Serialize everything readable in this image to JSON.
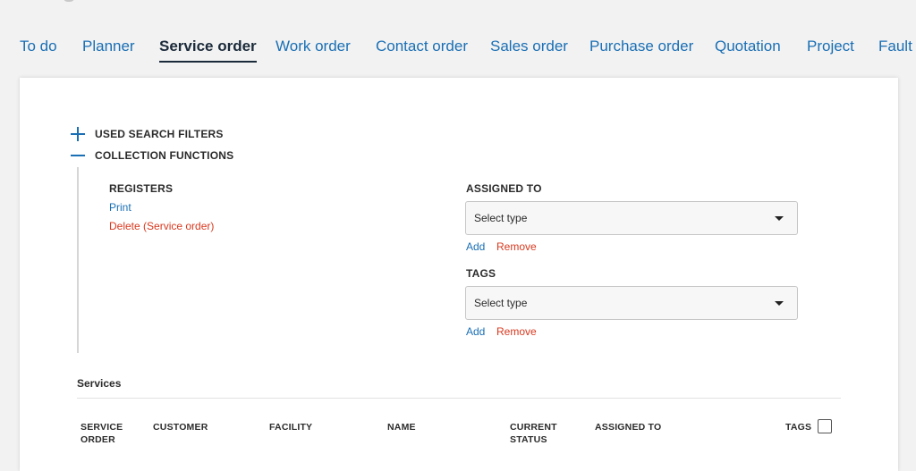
{
  "tabs": [
    {
      "label": "To do"
    },
    {
      "label": "Planner"
    },
    {
      "label": "Service order",
      "active": true
    },
    {
      "label": "Work order"
    },
    {
      "label": "Contact order"
    },
    {
      "label": "Sales order"
    },
    {
      "label": "Purchase order"
    },
    {
      "label": "Quotation"
    },
    {
      "label": "Project"
    },
    {
      "label": "Fault r"
    }
  ],
  "filters": {
    "used_search_filters": "USED SEARCH FILTERS",
    "collection_functions": "COLLECTION FUNCTIONS"
  },
  "registers": {
    "heading": "REGISTERS",
    "print": "Print",
    "delete": "Delete (Service order)"
  },
  "assigned_to": {
    "heading": "ASSIGNED TO",
    "select_value": "Select type",
    "add": "Add",
    "remove": "Remove"
  },
  "tags": {
    "heading": "TAGS",
    "select_value": "Select type",
    "add": "Add",
    "remove": "Remove"
  },
  "services": {
    "title": "Services",
    "columns": [
      {
        "line1": "SERVICE",
        "line2": "ORDER"
      },
      {
        "line1": "CUSTOMER",
        "line2": ""
      },
      {
        "line1": "FACILITY",
        "line2": ""
      },
      {
        "line1": "NAME",
        "line2": ""
      },
      {
        "line1": "CURRENT",
        "line2": "STATUS"
      },
      {
        "line1": "ASSIGNED TO",
        "line2": ""
      },
      {
        "line1": "TAGS",
        "line2": ""
      }
    ]
  },
  "colors": {
    "link": "#1a6fb5",
    "danger": "#d9381e",
    "active_tab": "#1b2a3a"
  }
}
